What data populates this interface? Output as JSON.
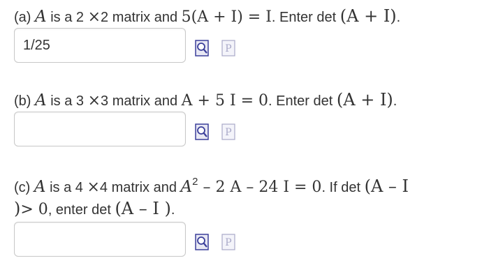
{
  "part_a": {
    "label": "(a)",
    "var": "A",
    "t1": "is a 2",
    "times": "×",
    "t2": "2 matrix and",
    "eq": "5(A + I) = I",
    "t3": ". Enter det",
    "expr": "(A + I)",
    "end": ".",
    "answer": "1/25"
  },
  "part_b": {
    "label": "(b)",
    "var": "A",
    "t1": "is a 3",
    "times": "×",
    "t2": "3 matrix and",
    "eq": "A + 5 I = 0",
    "t3": ". Enter det",
    "expr": "(A + I)",
    "end": ".",
    "answer": ""
  },
  "part_c": {
    "label": "(c)",
    "var": "A",
    "t1": "is a 4",
    "times": "×",
    "t2": "4 matrix and",
    "eq_a": "A",
    "eq_exp": "2",
    "eq_b": " – 2 A – 24 I = 0",
    "t3": ". If det",
    "expr_start": "(A – I",
    "line2_close": ")",
    "line2_gt": "> 0",
    "line2_text": ", enter det",
    "expr2": "(A – I )",
    "end": ".",
    "answer": ""
  },
  "icons": {
    "preview": "preview-magnifier-icon",
    "help": "help-p-icon",
    "preview_color": "#3b3f9a",
    "help_color": "#a9a9c8"
  }
}
